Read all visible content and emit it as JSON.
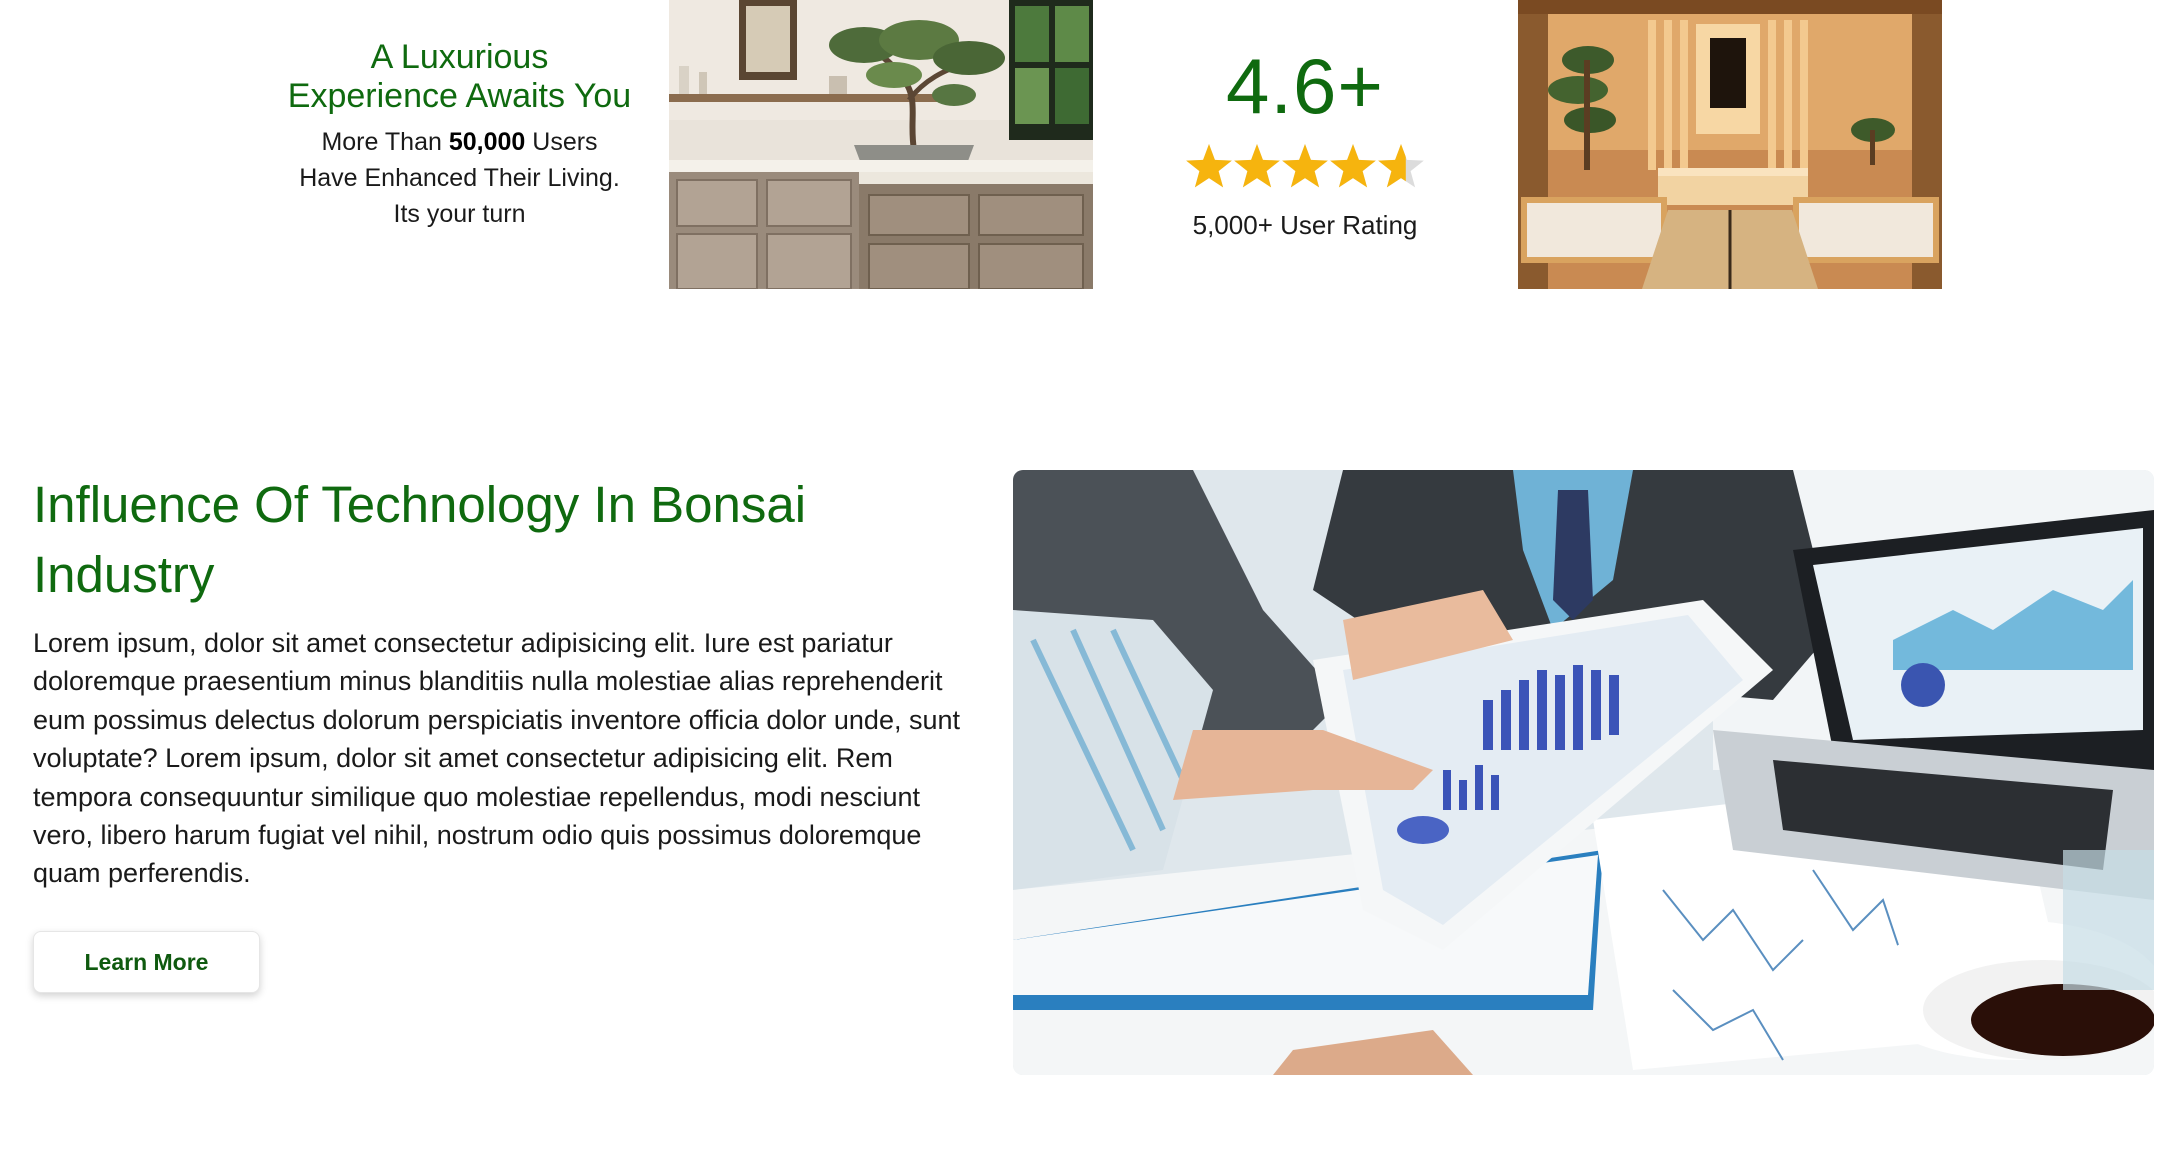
{
  "promo": {
    "heading_line1": "A Luxurious",
    "heading_line2": "Experience Awaits You",
    "text_prefix": "More Than ",
    "text_count": "50,000",
    "text_suffix": " Users",
    "text_line2": "Have Enhanced Their Living.",
    "text_line3": "Its your turn"
  },
  "rating": {
    "value": "4.6+",
    "stars": 4.6,
    "star_color": "#f6b40e",
    "caption": "5,000+ User Rating"
  },
  "images": {
    "kitchen": "kitchen-bonsai-photo",
    "room": "japanese-room-photo",
    "business": "business-tablet-photo"
  },
  "feature": {
    "title": "Influence Of Technology In Bonsai Industry",
    "body": "Lorem ipsum, dolor sit amet consectetur adipisicing elit. Iure est pariatur doloremque praesentium minus blanditiis nulla molestiae alias reprehenderit eum possimus delectus dolorum perspiciatis inventore officia dolor unde, sunt voluptate? Lorem ipsum, dolor sit amet consectetur adipisicing elit. Rem tempora consequuntur similique quo molestiae repellendus, modi nesciunt vero, libero harum fugiat vel nihil, nostrum odio quis possimus doloremque quam perferendis.",
    "button_label": "Learn More"
  },
  "colors": {
    "brand_green": "#0f6a0f",
    "text": "#1a1a1a"
  }
}
